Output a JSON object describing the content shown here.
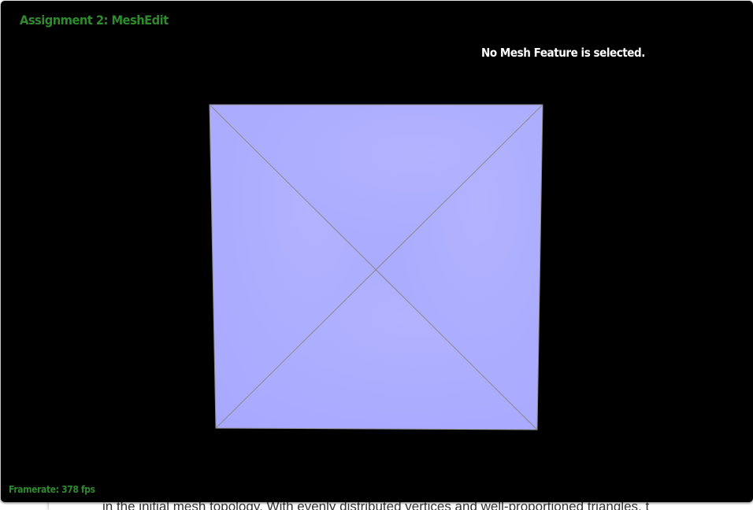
{
  "app": {
    "title": "Assignment 2: MeshEdit"
  },
  "status": {
    "message": "No Mesh Feature is selected."
  },
  "footer": {
    "framerate": "Framerate: 378 fps"
  },
  "background_document": {
    "text": "in the initial mesh topology. With evenly distributed vertices and well-proportioned triangles, t"
  },
  "colors": {
    "viewer_background": "#000000",
    "title_green": "#2f8a2f",
    "mesh_fill": "#aaaaff",
    "mesh_edge": "#8a8a8a"
  }
}
